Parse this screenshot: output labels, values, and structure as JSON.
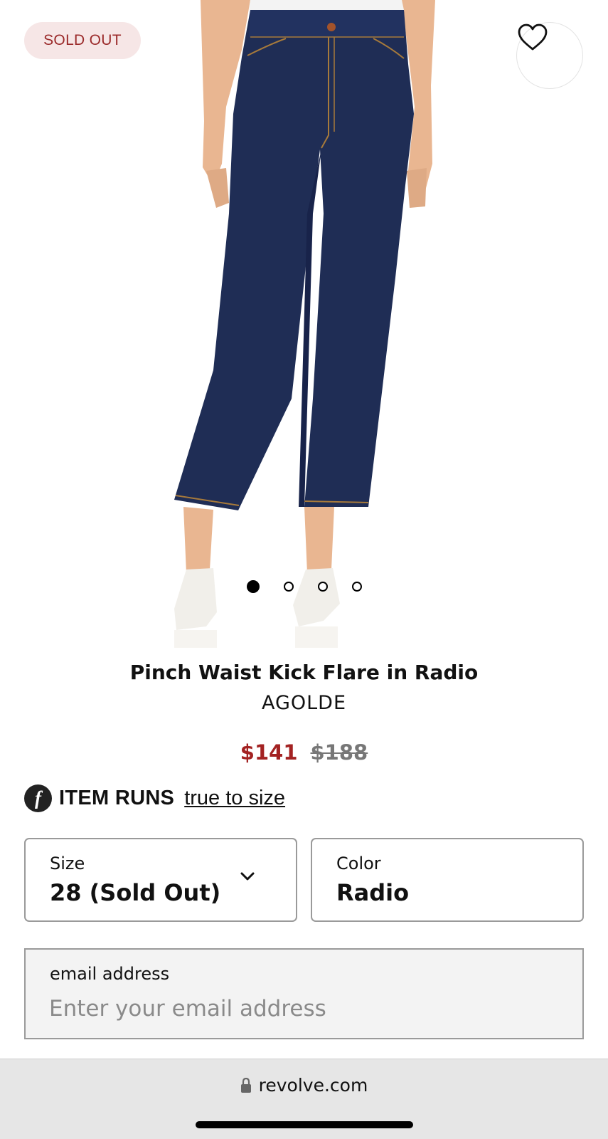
{
  "product": {
    "badge": "SOLD OUT",
    "title": "Pinch Waist Kick Flare in Radio",
    "brand": "AGOLDE",
    "price_sale": "$141",
    "price_original": "$188",
    "image_count": 4,
    "active_image_index": 0,
    "favorite_icon": "heart-outline-icon"
  },
  "fit": {
    "logo_letter": "f",
    "label": "ITEM RUNS",
    "value": "true to size"
  },
  "size_selector": {
    "label": "Size",
    "value": "28 (Sold Out)"
  },
  "color_selector": {
    "label": "Color",
    "value": "Radio"
  },
  "email": {
    "label": "email address",
    "placeholder": "Enter your email address",
    "value": ""
  },
  "browser": {
    "url": "revolve.com",
    "lock_icon": "lock-icon"
  },
  "colors": {
    "sale_red": "#a32222",
    "badge_bg": "#f6e6e6",
    "badge_text": "#9b2a2a",
    "denim": "#1f2d55"
  }
}
